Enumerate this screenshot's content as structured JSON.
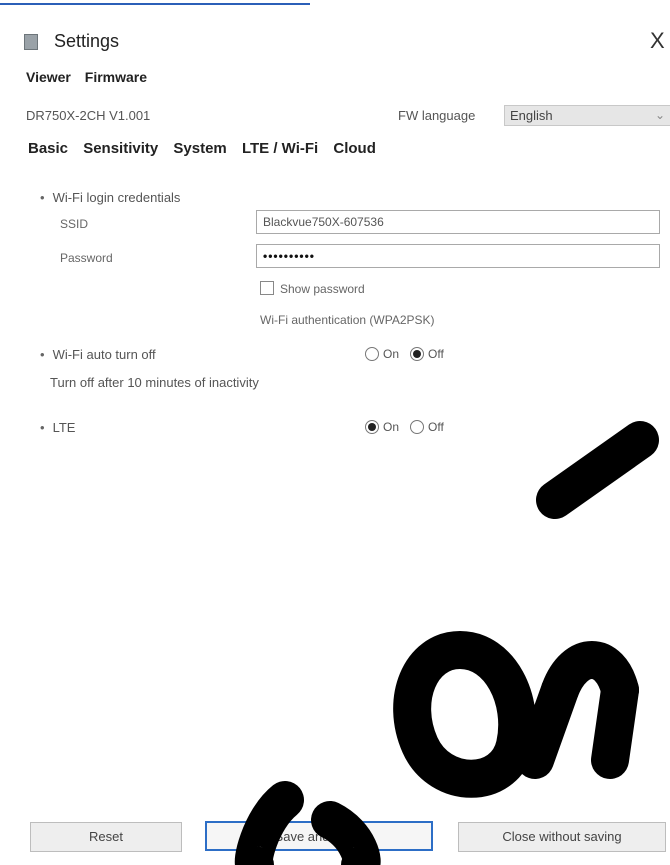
{
  "window": {
    "title": "Settings",
    "close_glyph": "X"
  },
  "top_tabs": [
    "Viewer",
    "Firmware"
  ],
  "device_id": "DR750X-2CH V1.001",
  "fw_language": {
    "label": "FW language",
    "value": "English"
  },
  "sub_tabs": [
    "Basic",
    "Sensitivity",
    "System",
    "LTE / Wi-Fi",
    "Cloud"
  ],
  "wifi_login": {
    "title": "Wi-Fi login credentials",
    "ssid_label": "SSID",
    "ssid_value": "Blackvue750X-607536",
    "password_label": "Password",
    "password_value": "••••••••••",
    "show_password_label": "Show password",
    "auth_label": "Wi-Fi authentication (WPA2PSK)"
  },
  "wifi_auto_off": {
    "title": "Wi-Fi auto turn off",
    "on_label": "On",
    "off_label": "Off",
    "selected": "Off",
    "note": "Turn off after 10 minutes of inactivity"
  },
  "lte": {
    "title": "LTE",
    "on_label": "On",
    "off_label": "Off",
    "selected": "On"
  },
  "buttons": {
    "reset": "Reset",
    "save_close": "Save and close",
    "close_no_save": "Close without saving"
  },
  "icons": [
    "app-icon",
    "close-icon"
  ]
}
